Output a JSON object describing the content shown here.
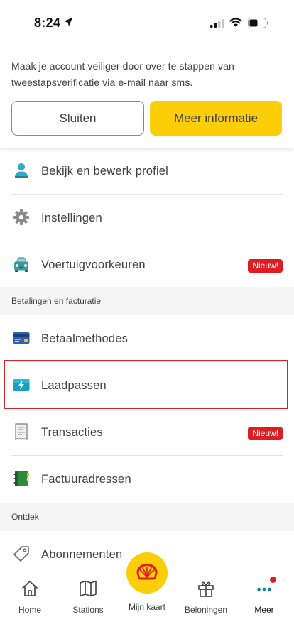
{
  "status_bar": {
    "time": "8:24"
  },
  "banner": {
    "text": "Maak je account veiliger door over te stappen van tweestapsverificatie via e-mail naar sms.",
    "close_label": "Sluiten",
    "more_label": "Meer informatie"
  },
  "menu": {
    "profile": {
      "label": "Bekijk en bewerk profiel",
      "icon": "person-icon"
    },
    "settings": {
      "label": "Instellingen",
      "icon": "gear-icon"
    },
    "vehicle": {
      "label": "Voertuigvoorkeuren",
      "icon": "car-icon",
      "badge": "Nieuw!"
    },
    "section_payments": "Betalingen en facturatie",
    "payment_methods": {
      "label": "Betaalmethodes",
      "icon": "credit-card-icon"
    },
    "charge_cards": {
      "label": "Laadpassen",
      "icon": "charge-card-icon"
    },
    "transactions": {
      "label": "Transacties",
      "icon": "receipt-icon",
      "badge": "Nieuw!"
    },
    "invoice_addresses": {
      "label": "Factuuradressen",
      "icon": "address-book-icon"
    },
    "section_discover": "Ontdek",
    "subscriptions": {
      "label": "Abonnementen",
      "icon": "tag-icon"
    }
  },
  "tabs": {
    "home": "Home",
    "stations": "Stations",
    "my_card": "Mijn kaart",
    "rewards": "Beloningen",
    "more": "Meer"
  },
  "colors": {
    "brand_yellow": "#fbce07",
    "badge_red": "#dd1d21",
    "highlight_red": "#d5262b",
    "teal": "#00858a"
  }
}
